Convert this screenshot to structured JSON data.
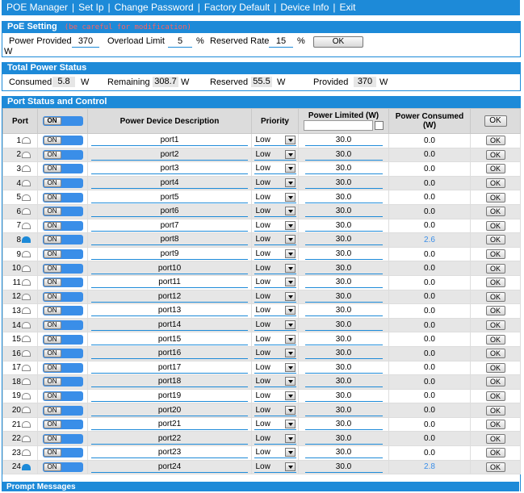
{
  "nav": {
    "items": [
      "POE Manager",
      "Set Ip",
      "Change Password",
      "Factory Default",
      "Device Info",
      "Exit"
    ]
  },
  "poe_setting": {
    "title": "PoE Setting",
    "hint": "(be careful for modification)",
    "power_provided_label": "Power Provided",
    "power_provided_value": "370",
    "power_provided_unit": "W",
    "overload_limit_label": "Overload Limit",
    "overload_limit_value": "5",
    "overload_limit_unit": "%",
    "reserved_rate_label": "Reserved Rate",
    "reserved_rate_value": "15",
    "reserved_rate_unit": "%",
    "ok_label": "OK"
  },
  "total_power": {
    "title": "Total Power Status",
    "consumed_label": "Consumed",
    "consumed_value": "5.8",
    "remaining_label": "Remaining",
    "remaining_value": "308.7",
    "reserved_label": "Reserved",
    "reserved_value": "55.5",
    "provided_label": "Provided",
    "provided_value": "370",
    "unit": "W"
  },
  "port_status": {
    "title": "Port Status and Control",
    "headers": {
      "port": "Port",
      "toggle": "ON",
      "description": "Power Device Description",
      "priority": "Priority",
      "limited": "Power Limited (W)",
      "consumed": "Power Consumed (W)",
      "ok": "OK"
    },
    "rows": [
      {
        "port": "1",
        "toggle": "ON",
        "desc": "port1",
        "priority": "Low",
        "limit": "30.0",
        "consumed": "0.0",
        "active": false,
        "ok": "OK"
      },
      {
        "port": "2",
        "toggle": "ON",
        "desc": "port2",
        "priority": "Low",
        "limit": "30.0",
        "consumed": "0.0",
        "active": false,
        "ok": "OK"
      },
      {
        "port": "3",
        "toggle": "ON",
        "desc": "port3",
        "priority": "Low",
        "limit": "30.0",
        "consumed": "0.0",
        "active": false,
        "ok": "OK"
      },
      {
        "port": "4",
        "toggle": "ON",
        "desc": "port4",
        "priority": "Low",
        "limit": "30.0",
        "consumed": "0.0",
        "active": false,
        "ok": "OK"
      },
      {
        "port": "5",
        "toggle": "ON",
        "desc": "port5",
        "priority": "Low",
        "limit": "30.0",
        "consumed": "0.0",
        "active": false,
        "ok": "OK"
      },
      {
        "port": "6",
        "toggle": "ON",
        "desc": "port6",
        "priority": "Low",
        "limit": "30.0",
        "consumed": "0.0",
        "active": false,
        "ok": "OK"
      },
      {
        "port": "7",
        "toggle": "ON",
        "desc": "port7",
        "priority": "Low",
        "limit": "30.0",
        "consumed": "0.0",
        "active": false,
        "ok": "OK"
      },
      {
        "port": "8",
        "toggle": "ON",
        "desc": "port8",
        "priority": "Low",
        "limit": "30.0",
        "consumed": "2.6",
        "active": true,
        "ok": "OK"
      },
      {
        "port": "9",
        "toggle": "ON",
        "desc": "port9",
        "priority": "Low",
        "limit": "30.0",
        "consumed": "0.0",
        "active": false,
        "ok": "OK"
      },
      {
        "port": "10",
        "toggle": "ON",
        "desc": "port10",
        "priority": "Low",
        "limit": "30.0",
        "consumed": "0.0",
        "active": false,
        "ok": "OK"
      },
      {
        "port": "11",
        "toggle": "ON",
        "desc": "port11",
        "priority": "Low",
        "limit": "30.0",
        "consumed": "0.0",
        "active": false,
        "ok": "OK"
      },
      {
        "port": "12",
        "toggle": "ON",
        "desc": "port12",
        "priority": "Low",
        "limit": "30.0",
        "consumed": "0.0",
        "active": false,
        "ok": "OK"
      },
      {
        "port": "13",
        "toggle": "ON",
        "desc": "port13",
        "priority": "Low",
        "limit": "30.0",
        "consumed": "0.0",
        "active": false,
        "ok": "OK"
      },
      {
        "port": "14",
        "toggle": "ON",
        "desc": "port14",
        "priority": "Low",
        "limit": "30.0",
        "consumed": "0.0",
        "active": false,
        "ok": "OK"
      },
      {
        "port": "15",
        "toggle": "ON",
        "desc": "port15",
        "priority": "Low",
        "limit": "30.0",
        "consumed": "0.0",
        "active": false,
        "ok": "OK"
      },
      {
        "port": "16",
        "toggle": "ON",
        "desc": "port16",
        "priority": "Low",
        "limit": "30.0",
        "consumed": "0.0",
        "active": false,
        "ok": "OK"
      },
      {
        "port": "17",
        "toggle": "ON",
        "desc": "port17",
        "priority": "Low",
        "limit": "30.0",
        "consumed": "0.0",
        "active": false,
        "ok": "OK"
      },
      {
        "port": "18",
        "toggle": "ON",
        "desc": "port18",
        "priority": "Low",
        "limit": "30.0",
        "consumed": "0.0",
        "active": false,
        "ok": "OK"
      },
      {
        "port": "19",
        "toggle": "ON",
        "desc": "port19",
        "priority": "Low",
        "limit": "30.0",
        "consumed": "0.0",
        "active": false,
        "ok": "OK"
      },
      {
        "port": "20",
        "toggle": "ON",
        "desc": "port20",
        "priority": "Low",
        "limit": "30.0",
        "consumed": "0.0",
        "active": false,
        "ok": "OK"
      },
      {
        "port": "21",
        "toggle": "ON",
        "desc": "port21",
        "priority": "Low",
        "limit": "30.0",
        "consumed": "0.0",
        "active": false,
        "ok": "OK"
      },
      {
        "port": "22",
        "toggle": "ON",
        "desc": "port22",
        "priority": "Low",
        "limit": "30.0",
        "consumed": "0.0",
        "active": false,
        "ok": "OK"
      },
      {
        "port": "23",
        "toggle": "ON",
        "desc": "port23",
        "priority": "Low",
        "limit": "30.0",
        "consumed": "0.0",
        "active": false,
        "ok": "OK"
      },
      {
        "port": "24",
        "toggle": "ON",
        "desc": "port24",
        "priority": "Low",
        "limit": "30.0",
        "consumed": "2.8",
        "active": true,
        "ok": "OK"
      }
    ]
  },
  "prompt": {
    "title": "Prompt Messages"
  },
  "colors": {
    "accent": "#1d8ad8",
    "toggle": "#3a8ee8",
    "hint": "#ff6060",
    "active_value": "#3a8ee8"
  },
  "icons": {
    "port_status": "plug-icon",
    "dropdown": "chevron-down-icon"
  }
}
